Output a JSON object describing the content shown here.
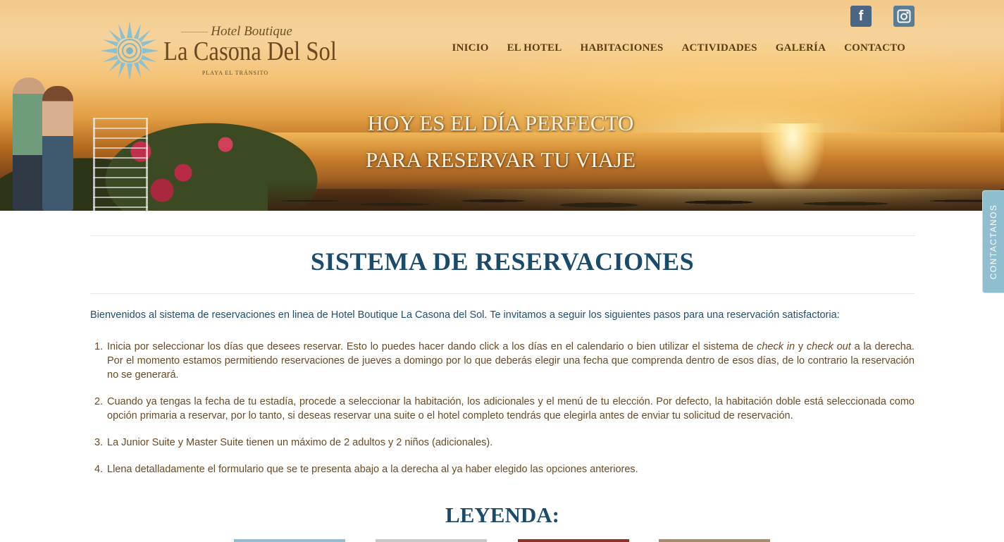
{
  "header": {
    "brand_top": "Hotel Boutique",
    "brand_main": "La Casona Del Sol",
    "brand_sub": "PLAYA EL TRÁNSITO",
    "social": [
      {
        "name": "facebook",
        "icon": "facebook-icon",
        "glyph": "f"
      },
      {
        "name": "instagram",
        "icon": "instagram-icon"
      }
    ],
    "nav": [
      "INICIO",
      "EL HOTEL",
      "HABITACIONES",
      "ACTIVIDADES",
      "GALERÍA",
      "CONTACTO"
    ]
  },
  "hero": {
    "line1": "HOY ES EL DÍA PERFECTO",
    "line2": "PARA RESERVAR TU VIAJE"
  },
  "side_tab": {
    "label": "CONTACTANOS"
  },
  "main": {
    "title": "SISTEMA DE RESERVACIONES",
    "intro": "Bienvenidos al sistema de reservaciones en linea de Hotel Boutique La Casona del Sol. Te invitamos a seguir los siguientes pasos para una reservación satisfactoria:",
    "steps": [
      {
        "num": "1.",
        "a": "Inicia por seleccionar los días que desees reservar. Esto lo puedes hacer dando click a los días en el calendario o bien utilizar el sistema de ",
        "em1": "check in",
        "b": " y ",
        "em2": "check out",
        "c": " a la derecha. Por el momento estamos permitiendo reservaciones de jueves a domingo por lo que deberás elegir una fecha que comprenda dentro de esos días, de lo contrario la reservación no se generará."
      },
      {
        "num": "2.",
        "text": "Cuando ya tengas la fecha de tu estadía, procede a seleccionar la habitación, los adicionales y el menú de tu elección. Por defecto, la habitación doble está seleccionada como opción primaria a reservar, por lo tanto, si deseas reservar una suite o el hotel completo tendrás que elegirla antes de enviar tu solicitud de reservación."
      },
      {
        "num": "3.",
        "text": "La Junior Suite y Master Suite tienen un máximo de 2 adultos y 2 niños (adicionales)."
      },
      {
        "num": "4.",
        "text": "Llena detalladamente el formulario que se te presenta abajo a la derecha al ya haber elegido las opciones anteriores."
      }
    ],
    "legend_title": "LEYENDA:",
    "legend_colors": [
      "#8fbfd0",
      "#c8c8c8",
      "#8a3324",
      "#a58d6c"
    ]
  },
  "colors": {
    "heading": "#1a4b6b",
    "body_text": "#6b4a22",
    "nav_text": "#5b3c15",
    "side_tab": "#8fbecf"
  }
}
